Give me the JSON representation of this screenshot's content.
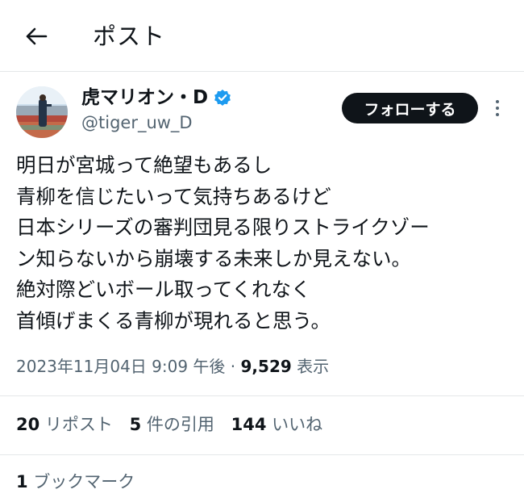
{
  "header": {
    "title": "ポスト",
    "back_icon": "arrow-left-icon"
  },
  "author": {
    "display_name": "虎マリオン・D",
    "handle": "@tiger_uw_D",
    "verified": true,
    "verified_color": "#1d9bf0"
  },
  "actions": {
    "follow_label": "フォローする",
    "more_icon": "more-vertical-icon"
  },
  "tweet": {
    "lines": [
      "明日が宮城って絶望もあるし",
      "青柳を信じたいって気持ちあるけど",
      "日本シリーズの審判団見る限りストライクゾー",
      "ン知らないから崩壊する未来しか見えない。",
      "絶対際どいボール取ってくれなく",
      "首傾げまくる青柳が現れると思う。"
    ]
  },
  "meta": {
    "timestamp": "2023年11月04日 9:09 午後",
    "separator": "·",
    "views_count": "9,529",
    "views_label": "表示"
  },
  "stats": {
    "reposts_count": "20",
    "reposts_label": "リポスト",
    "quotes_count": "5",
    "quotes_label": "件の引用",
    "likes_count": "144",
    "likes_label": "いいね"
  },
  "bookmarks": {
    "count": "1",
    "label": "ブックマーク"
  }
}
